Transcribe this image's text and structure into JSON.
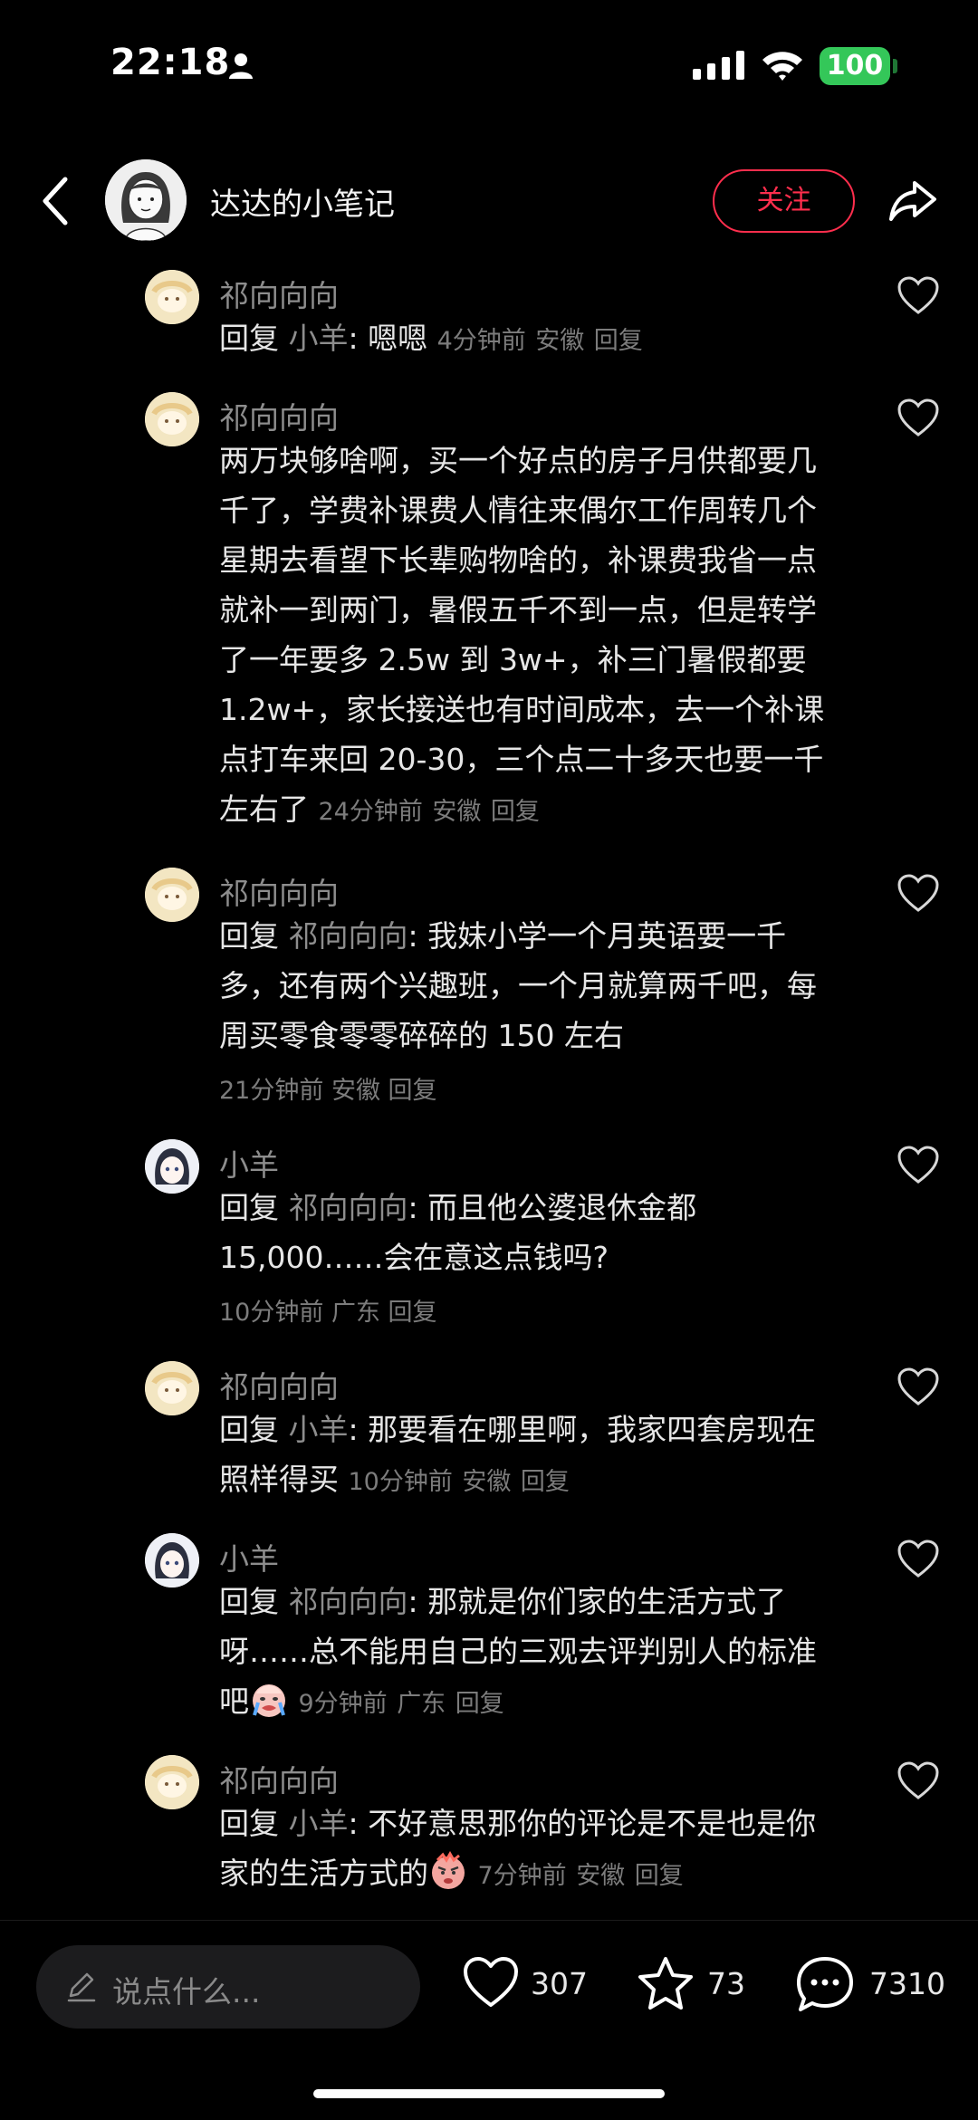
{
  "status_bar": {
    "time": "22:18",
    "battery": "100"
  },
  "header": {
    "author": "达达的小笔记",
    "follow_label": "关注"
  },
  "comments": [
    {
      "name": "祁向向向",
      "reply_word": "回复",
      "reply_to": "小羊",
      "text": ": 嗯嗯",
      "time": "4分钟前",
      "location": "安徽",
      "reply_label": "回复"
    },
    {
      "name": "祁向向向",
      "lines": [
        "两万块够啥啊，买一个好点的房子月供都要几",
        "千了，学费补课费人情往来偶尔工作周转几个",
        "星期去看望下长辈购物啥的，补课费我省一点",
        "就补一到两门，暑假五千不到一点，但是转学",
        "了一年要多 2.5w 到 3w+，补三门暑假都要",
        "1.2w+，家长接送也有时间成本，去一个补课",
        "点打车来回 20-30，三个点二十多天也要一千",
        "左右了"
      ],
      "time": "24分钟前",
      "location": "安徽",
      "reply_label": "回复"
    },
    {
      "name": "祁向向向",
      "reply_word": "回复",
      "reply_to": "祁向向向",
      "lines": [
        ": 我妹小学一个月英语要一千",
        "多，还有两个兴趣班，一个月就算两千吧，每",
        "周买零食零零碎碎的 150 左右"
      ],
      "time": "21分钟前",
      "location": "安徽",
      "reply_label": "回复"
    },
    {
      "name": "小羊",
      "reply_word": "回复",
      "reply_to": "祁向向向",
      "lines": [
        ": 而且他公婆退休金都",
        "15,000……会在意这点钱吗?"
      ],
      "time": "10分钟前",
      "location": "广东",
      "reply_label": "回复"
    },
    {
      "name": "祁向向向",
      "reply_word": "回复",
      "reply_to": "小羊",
      "lines": [
        ": 那要看在哪里啊，我家四套房现在",
        "照样得买"
      ],
      "time": "10分钟前",
      "location": "安徽",
      "reply_label": "回复"
    },
    {
      "name": "小羊",
      "reply_word": "回复",
      "reply_to": "祁向向向",
      "lines": [
        ": 那就是你们家的生活方式了",
        "呀……总不能用自己的三观去评判别人的标准",
        "吧"
      ],
      "time": "9分钟前",
      "location": "广东",
      "reply_label": "回复"
    },
    {
      "name": "祁向向向",
      "reply_word": "回复",
      "reply_to": "小羊",
      "lines": [
        ": 不好意思那你的评论是不是也是你",
        "家的生活方式的"
      ],
      "time": "7分钟前",
      "location": "安徽",
      "reply_label": "回复"
    }
  ],
  "bottom_bar": {
    "placeholder": "说点什么...",
    "likes": "307",
    "stars": "73",
    "comments": "7310"
  },
  "colors": {
    "follow": "#ff2e4d",
    "battery": "#34c759"
  }
}
